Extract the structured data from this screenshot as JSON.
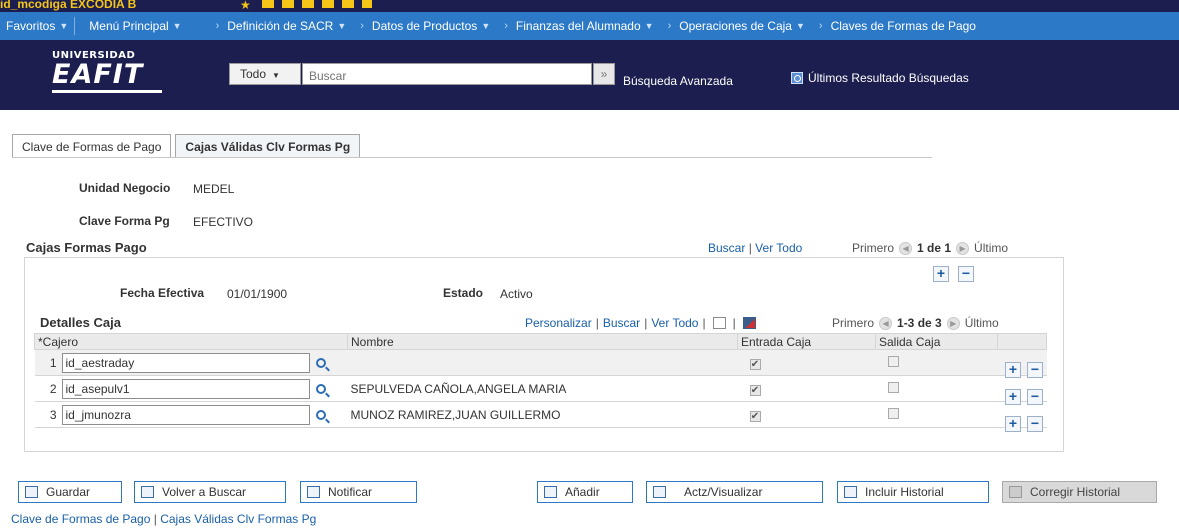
{
  "nav": {
    "favorites": "Favoritos",
    "main_menu": "Menú Principal",
    "crumbs": [
      "Definición de SACR",
      "Datos de Productos",
      "Finanzas del Alumnado",
      "Operaciones de Caja",
      "Claves de Formas de Pago"
    ]
  },
  "header": {
    "logo_top": "UNIVERSIDAD",
    "logo_main": "EAFIT",
    "search_scope": "Todo",
    "search_placeholder": "Buscar",
    "advanced_search": "Búsqueda Avanzada",
    "last_results": "Últimos Resultado Búsquedas"
  },
  "tabs": [
    "Clave de Formas de Pago",
    "Cajas Válidas Clv Formas Pg"
  ],
  "fields": {
    "unidad_label": "Unidad Negocio",
    "unidad_value": "MEDEL",
    "clave_label": "Clave Forma Pg",
    "clave_value": "EFECTIVO",
    "fecha_label": "Fecha Efectiva",
    "fecha_value": "01/01/1900",
    "estado_label": "Estado",
    "estado_value": "Activo"
  },
  "group": {
    "title": "Cajas Formas Pago",
    "find": "Buscar",
    "view_all": "Ver Todo",
    "first": "Primero",
    "count": "1 de 1",
    "last": "Último"
  },
  "grid": {
    "title": "Detalles Caja",
    "personalize": "Personalizar",
    "find": "Buscar",
    "view_all": "Ver Todo",
    "first": "Primero",
    "count": "1-3 de 3",
    "last": "Último",
    "columns": [
      "*Cajero",
      "Nombre",
      "Entrada Caja",
      "Salida Caja"
    ],
    "rows": [
      {
        "num": "1",
        "cajero": "id_aestraday",
        "nombre": "",
        "entrada": true,
        "salida": false
      },
      {
        "num": "2",
        "cajero": "id_asepulv1",
        "nombre": "SEPULVEDA CAÑOLA,ANGELA MARIA",
        "entrada": true,
        "salida": false
      },
      {
        "num": "3",
        "cajero": "id_jmunozra",
        "nombre": "MUNOZ RAMIREZ,JUAN GUILLERMO",
        "entrada": true,
        "salida": false
      }
    ]
  },
  "buttons": {
    "save": "Guardar",
    "return_search": "Volver a Buscar",
    "notify": "Notificar",
    "add": "Añadir",
    "update_display": "Actz/Visualizar",
    "include_history": "Incluir Historial",
    "correct_history": "Corregir Historial"
  },
  "footer": {
    "link1": "Clave de Formas de Pago",
    "link2": "Cajas Válidas Clv Formas Pg"
  }
}
